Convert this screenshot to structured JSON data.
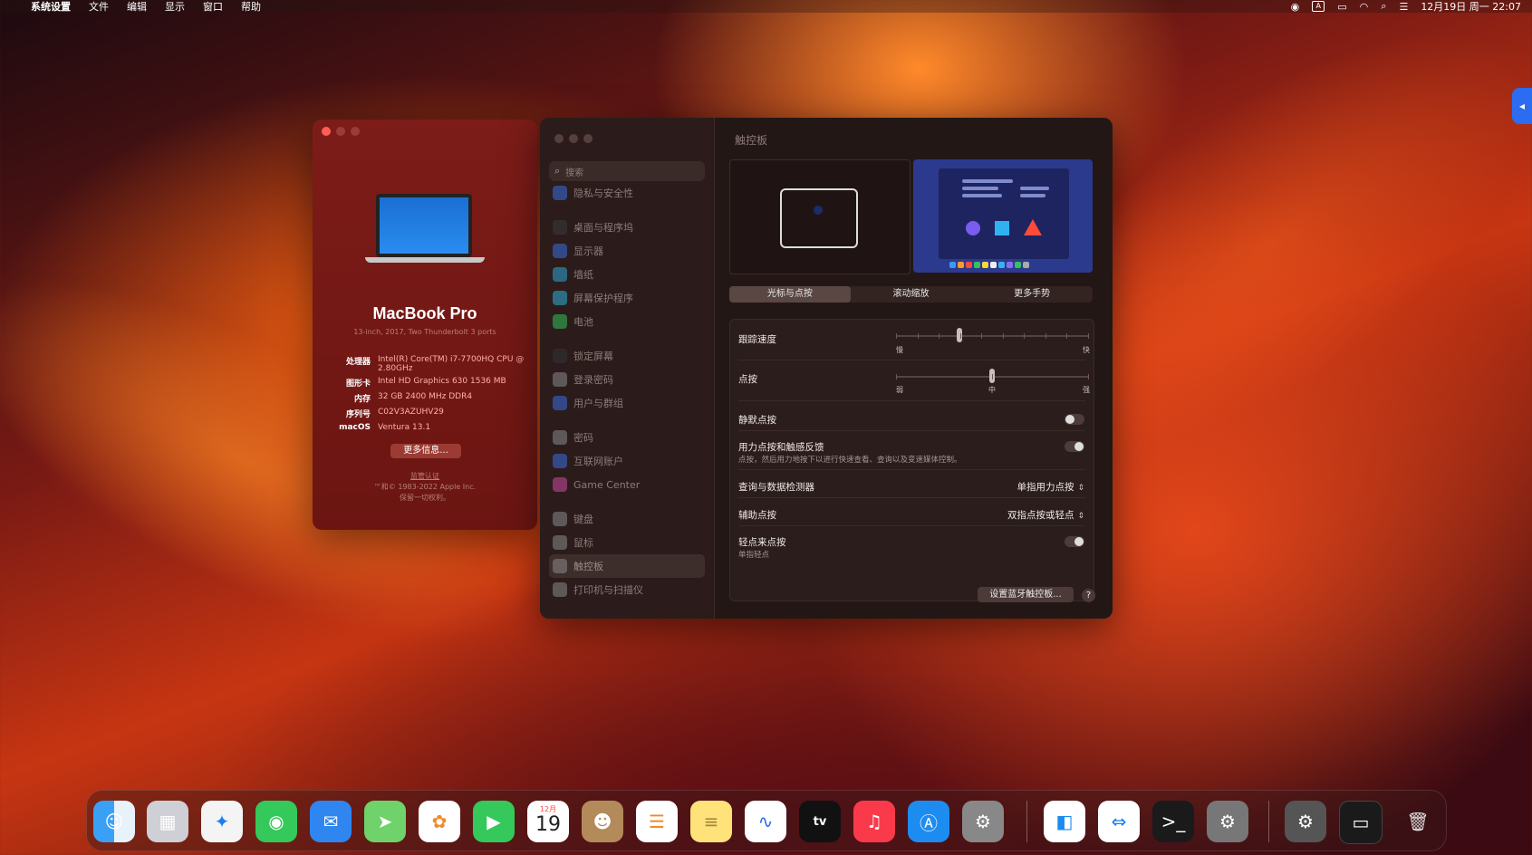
{
  "menubar": {
    "app": "系统设置",
    "items": [
      "文件",
      "编辑",
      "显示",
      "窗口",
      "帮助"
    ],
    "input_badge": "A",
    "datetime": "12月19日 周一 22:07"
  },
  "about": {
    "model": "MacBook Pro",
    "submodel": "13-inch, 2017, Two Thunderbolt 3 ports",
    "specs": [
      {
        "k": "处理器",
        "v": "Intel(R) Core(TM) i7-7700HQ CPU @ 2.80GHz"
      },
      {
        "k": "图形卡",
        "v": "Intel HD Graphics 630 1536 MB"
      },
      {
        "k": "内存",
        "v": "32 GB 2400 MHz DDR4"
      },
      {
        "k": "序列号",
        "v": "C02V3AZUHV29"
      },
      {
        "k": "macOS",
        "v": "Ventura 13.1"
      }
    ],
    "more_btn": "更多信息...",
    "legal1": "监管认证",
    "legal2": "™和© 1983-2022 Apple Inc.",
    "legal3": "保留一切权利。"
  },
  "settings": {
    "search_placeholder": "搜索",
    "sidebar": [
      {
        "label": "隐私与安全性",
        "color": "#3b6ee0"
      },
      {
        "label": "桌面与程序坞",
        "color": "#3a3a3a"
      },
      {
        "label": "显示器",
        "color": "#3b6ee0"
      },
      {
        "label": "墙纸",
        "color": "#2fa8d8"
      },
      {
        "label": "屏幕保护程序",
        "color": "#2fb0d8"
      },
      {
        "label": "电池",
        "color": "#35c25a"
      },
      {
        "label": "锁定屏幕",
        "color": "#333333"
      },
      {
        "label": "登录密码",
        "color": "#8a8a8a"
      },
      {
        "label": "用户与群组",
        "color": "#3b6ee0"
      },
      {
        "label": "密码",
        "color": "#8a8a8a"
      },
      {
        "label": "互联网账户",
        "color": "#3b6ee0"
      },
      {
        "label": "Game Center",
        "color": "#d04aa0"
      },
      {
        "label": "键盘",
        "color": "#8a8a8a"
      },
      {
        "label": "鼠标",
        "color": "#8a8a8a"
      },
      {
        "label": "触控板",
        "color": "#8a8a8a"
      },
      {
        "label": "打印机与扫描仪",
        "color": "#8a8a8a"
      }
    ],
    "title": "触控板",
    "tabs": [
      "光标与点按",
      "滚动缩放",
      "更多手势"
    ],
    "selected_tab": 0,
    "tracking": {
      "label": "跟踪速度",
      "min": "慢",
      "max": "快",
      "level": 0.33
    },
    "click": {
      "label": "点按",
      "min": "弱",
      "mid": "中",
      "max": "强",
      "level": 0.5
    },
    "silent_click": {
      "label": "静默点按",
      "on": false
    },
    "force_click": {
      "label": "用力点按和触感反馈",
      "note": "点按，然后用力地按下以进行快速查看、查询以及变速媒体控制。",
      "on": true
    },
    "lookup": {
      "label": "查询与数据检测器",
      "value": "单指用力点按"
    },
    "secondary": {
      "label": "辅助点按",
      "value": "双指点按或轻点"
    },
    "tap": {
      "label": "轻点来点按",
      "note": "单指轻点",
      "on": true
    },
    "bt_button": "设置蓝牙触控板...",
    "help": "?"
  },
  "dock": {
    "calendar_month": "12月",
    "calendar_day": "19",
    "tv_label": "tv"
  }
}
